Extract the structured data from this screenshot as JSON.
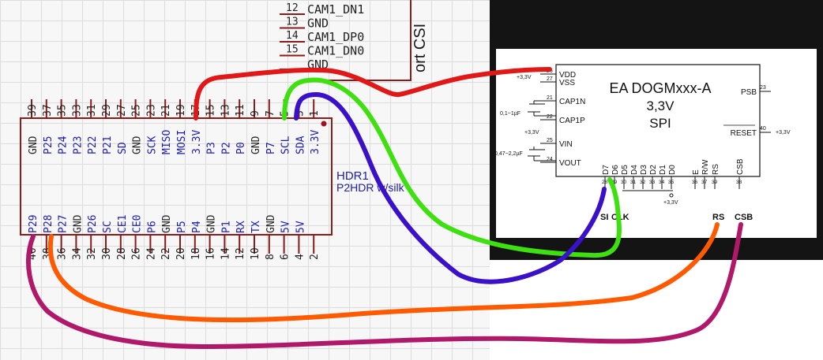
{
  "connector": {
    "pins": [
      {
        "num": "12",
        "name": "CAM1_DN1"
      },
      {
        "num": "13",
        "name": "GND"
      },
      {
        "num": "14",
        "name": "CAM1_DP0"
      },
      {
        "num": "15",
        "name": "CAM1_DN0"
      },
      {
        "num": "",
        "name": "GND"
      }
    ],
    "port_label": "ort CSI"
  },
  "header": {
    "name": "HDR1",
    "value": "P2HDR w/silk",
    "top_numbers": [
      "39",
      "37",
      "35",
      "33",
      "31",
      "29",
      "27",
      "25",
      "23",
      "21",
      "19",
      "17",
      "15",
      "13",
      "11",
      "9",
      "7",
      "5",
      "3",
      "1"
    ],
    "top_labels": [
      "GND",
      "P25",
      "P24",
      "P23",
      "P22",
      "P21",
      "SD",
      "GND",
      "SCK",
      "MISO",
      "MOSI",
      "3.3V",
      "P3",
      "P2",
      "P0",
      "GND",
      "P7",
      "SCL",
      "SDA",
      "3.3V"
    ],
    "bottom_labels": [
      "P29",
      "P28",
      "P27",
      "GND",
      "P26",
      "SC",
      "CE1",
      "CE0",
      "P6",
      "GND",
      "P5",
      "P4",
      "GND",
      "P1",
      "RX",
      "TX",
      "GND",
      "5V",
      "5V"
    ],
    "bottom_numbers": [
      "40",
      "38",
      "36",
      "34",
      "32",
      "30",
      "28",
      "26",
      "24",
      "22",
      "20",
      "18",
      "16",
      "14",
      "12",
      "10",
      "8",
      "6",
      "4",
      "2"
    ]
  },
  "display": {
    "title": "EA DOGMxxx-A",
    "voltage": "3,3V",
    "interface": "SPI",
    "left_pins": [
      {
        "num": "26",
        "name": "VDD"
      },
      {
        "num": "27",
        "name": "VSS"
      },
      {
        "num": "21",
        "name": "CAP1N"
      },
      {
        "num": "22",
        "name": "CAP1P"
      },
      {
        "num": "25",
        "name": "VIN"
      },
      {
        "num": "24",
        "name": "VOUT"
      }
    ],
    "supply_labels": [
      "+3,3V",
      "+3,3V",
      "+3,3V",
      "+3,3V"
    ],
    "cap1_label": "0,1~1µF",
    "cap2_label": "0,47~2,2µF",
    "right_pins": [
      {
        "num": "23",
        "name": "PSB"
      },
      {
        "num": "40",
        "name": "RESET"
      }
    ],
    "bottom_pins": [
      {
        "name": "D7",
        "num": "28"
      },
      {
        "name": "D6",
        "num": "29"
      },
      {
        "name": "D5",
        "num": "30"
      },
      {
        "name": "D4",
        "num": "31"
      },
      {
        "name": "D3",
        "num": "32"
      },
      {
        "name": "D2",
        "num": "33"
      },
      {
        "name": "D1",
        "num": "34"
      },
      {
        "name": "D0",
        "num": "35"
      },
      {
        "name": "E",
        "num": "36"
      },
      {
        "name": "R/W",
        "num": "37"
      },
      {
        "name": "RS",
        "num": "39"
      },
      {
        "name": "CSB",
        "num": "38"
      }
    ],
    "signal_labels": [
      "SI",
      "CLK",
      "RS",
      "CSB"
    ]
  },
  "wires": {
    "colors": {
      "red": "#e01818",
      "green": "#3ee010",
      "blue": "#3a10c8",
      "orange": "#ff5a00",
      "magenta": "#b0186a"
    }
  }
}
